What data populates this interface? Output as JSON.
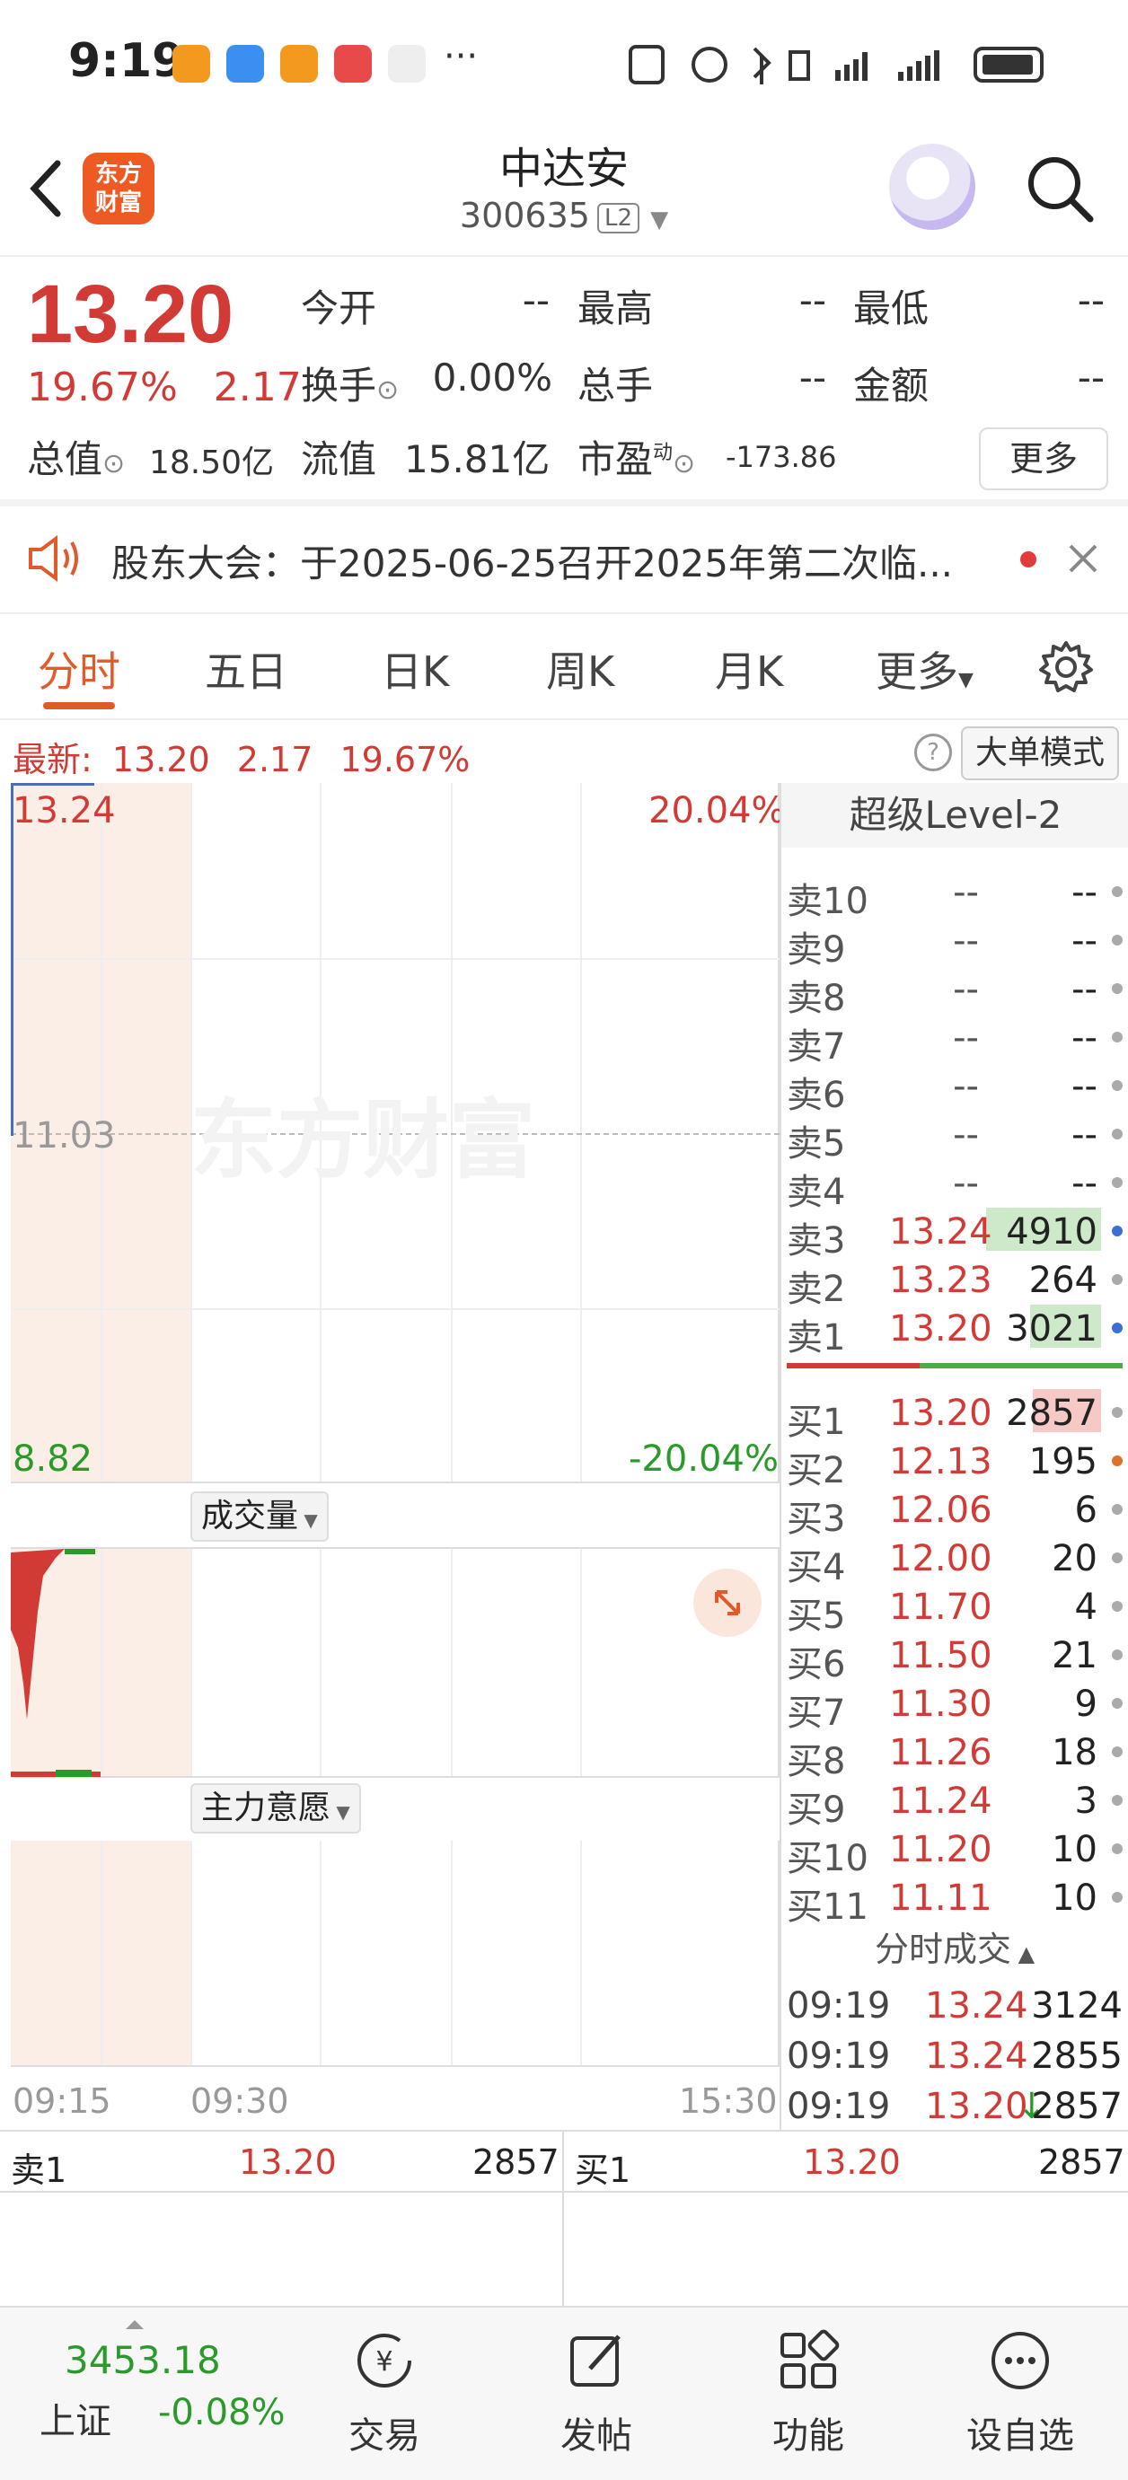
{
  "status_bar": {
    "time": "9:19",
    "more": "···"
  },
  "header": {
    "logo_line1": "东方",
    "logo_line2": "财富",
    "stock_name": "中达安",
    "stock_code": "300635",
    "level_badge": "L2"
  },
  "quote": {
    "price": "13.20",
    "change_pct": "19.67%",
    "change_amt": "2.17",
    "open_label": "今开",
    "open_value": "--",
    "high_label": "最高",
    "high_value": "--",
    "low_label": "最低",
    "low_value": "--",
    "turnover_label": "换手",
    "turnover_value": "0.00%",
    "volume_label": "总手",
    "volume_value": "--",
    "amount_label": "金额",
    "amount_value": "--",
    "mcap_label": "总值",
    "mcap_value": "18.50亿",
    "float_label": "流值",
    "float_value": "15.81亿",
    "pe_label": "市盈",
    "pe_sup": "动",
    "pe_value": "-173.86",
    "more_button": "更多"
  },
  "notice": {
    "text": "股东大会：于2025-06-25召开2025年第二次临..."
  },
  "tabs": [
    "分时",
    "五日",
    "日K",
    "周K",
    "月K",
    "更多"
  ],
  "info_line": {
    "latest_label": "最新:",
    "price": "13.20",
    "change": "2.17",
    "pct": "19.67%",
    "mode_button": "大单模式"
  },
  "chart": {
    "high_price": "13.24",
    "high_pct": "20.04%",
    "mid_price": "11.03",
    "low_price": "8.82",
    "low_pct": "-20.04%",
    "watermark": "东方财富",
    "volume_label": "成交量",
    "main_force_label": "主力意愿",
    "time_labels": [
      "09:15",
      "09:30",
      "15:30"
    ]
  },
  "order_book": {
    "title": "超级Level-2",
    "asks": [
      {
        "label": "卖10",
        "price": "--",
        "vol": "--"
      },
      {
        "label": "卖9",
        "price": "--",
        "vol": "--"
      },
      {
        "label": "卖8",
        "price": "--",
        "vol": "--"
      },
      {
        "label": "卖7",
        "price": "--",
        "vol": "--"
      },
      {
        "label": "卖6",
        "price": "--",
        "vol": "--"
      },
      {
        "label": "卖5",
        "price": "--",
        "vol": "--"
      },
      {
        "label": "卖4",
        "price": "--",
        "vol": "--"
      },
      {
        "label": "卖3",
        "price": "13.24",
        "vol": "4910"
      },
      {
        "label": "卖2",
        "price": "13.23",
        "vol": "264"
      },
      {
        "label": "卖1",
        "price": "13.20",
        "vol": "3021"
      }
    ],
    "bids": [
      {
        "label": "买1",
        "price": "13.20",
        "vol": "2857"
      },
      {
        "label": "买2",
        "price": "12.13",
        "vol": "195"
      },
      {
        "label": "买3",
        "price": "12.06",
        "vol": "6"
      },
      {
        "label": "买4",
        "price": "12.00",
        "vol": "20"
      },
      {
        "label": "买5",
        "price": "11.70",
        "vol": "4"
      },
      {
        "label": "买6",
        "price": "11.50",
        "vol": "21"
      },
      {
        "label": "买7",
        "price": "11.30",
        "vol": "9"
      },
      {
        "label": "买8",
        "price": "11.26",
        "vol": "18"
      },
      {
        "label": "买9",
        "price": "11.24",
        "vol": "3"
      },
      {
        "label": "买10",
        "price": "11.20",
        "vol": "10"
      },
      {
        "label": "买11",
        "price": "11.11",
        "vol": "10"
      }
    ],
    "trades_title": "分时成交",
    "trades": [
      {
        "time": "09:19",
        "price": "13.24",
        "vol": "3124"
      },
      {
        "time": "09:19",
        "price": "13.24",
        "vol": "2855"
      },
      {
        "time": "09:19",
        "price": "13.20",
        "vol": "2857"
      }
    ]
  },
  "summary_row": {
    "sell_label": "卖1",
    "sell_price": "13.20",
    "sell_vol": "2857",
    "buy_label": "买1",
    "buy_price": "13.20",
    "buy_vol": "2857"
  },
  "bottom_nav": {
    "index_value": "3453.18",
    "index_name": "上证",
    "index_pct": "-0.08%",
    "items": [
      "交易",
      "发帖",
      "功能",
      "设自选"
    ]
  },
  "colors": {
    "up": "#d23a35",
    "down": "#2a9a2a",
    "accent": "#e05a2a"
  }
}
